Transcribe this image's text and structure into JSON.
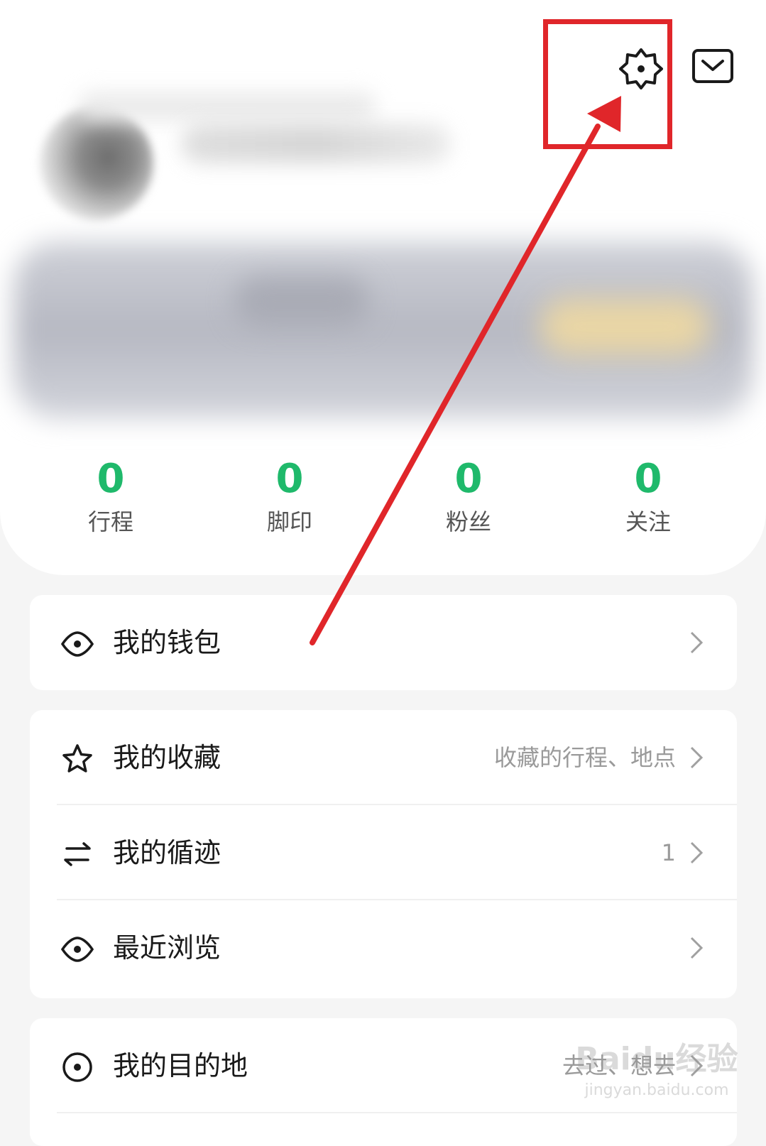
{
  "stats": [
    {
      "value": "0",
      "label": "行程"
    },
    {
      "value": "0",
      "label": "脚印"
    },
    {
      "value": "0",
      "label": "粉丝"
    },
    {
      "value": "0",
      "label": "关注"
    }
  ],
  "menu": {
    "wallet": {
      "label": "我的钱包"
    },
    "favorites": {
      "label": "我的收藏",
      "extra": "收藏的行程、地点"
    },
    "tracks": {
      "label": "我的循迹",
      "extra": "1"
    },
    "recent": {
      "label": "最近浏览"
    },
    "destinations": {
      "label": "我的目的地",
      "extra": "去过、想去"
    }
  },
  "watermark": {
    "main": "Baidu经验",
    "sub": "jingyan.baidu.com"
  },
  "colors": {
    "accent": "#1fb96b",
    "annotation": "#e0262a"
  },
  "icons": {
    "settings": "gear-icon",
    "message": "message-icon",
    "wallet": "eye-icon",
    "favorites": "star-icon",
    "tracks": "swap-arrows-icon",
    "recent": "eye-icon",
    "destinations": "target-icon"
  }
}
